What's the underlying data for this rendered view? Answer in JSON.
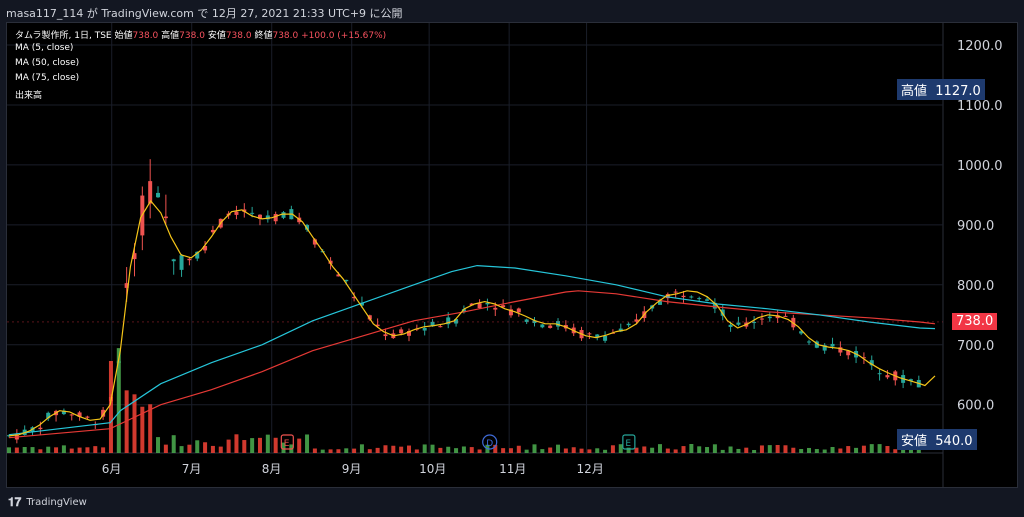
{
  "caption": "masa117_114 が TradingView.com で 12月 27, 2021 21:33 UTC+9 に公開",
  "legend": {
    "symbol": "タムラ製作所, 1日, TSE",
    "ohlc_labels": {
      "open": "始値",
      "high": "高値",
      "low": "安値",
      "close": "終値"
    },
    "open": "738.0",
    "high": "738.0",
    "low": "738.0",
    "close": "738.0",
    "change": "+100.0 (+15.67%)",
    "ma5": "MA (5, close)",
    "ma50": "MA (50, close)",
    "ma75": "MA (75, close)",
    "volume": "出来高"
  },
  "price_axis": {
    "ticks": [
      "1200.0",
      "1100.0",
      "1000.0",
      "900.0",
      "800.0",
      "700.0",
      "600.0"
    ],
    "high_label": "高値",
    "high_value": "1127.0",
    "low_label": "安値",
    "low_value": "540.0",
    "last_value": "738.0"
  },
  "events": [
    "E",
    "D",
    "E"
  ],
  "footer": {
    "logo": "TradingView"
  },
  "colors": {
    "up": "#26a69a",
    "down": "#ef5350",
    "ma5": "#f5c518",
    "ma50": "#26c6da",
    "ma75": "#e53935",
    "vol_up": "#4caf50",
    "vol_down": "#f44336",
    "high_low_tag": "#1e3a6e",
    "last_tag": "#f23645"
  },
  "chart_data": {
    "type": "candlestick",
    "ylim": [
      520,
      1240
    ],
    "months": [
      "6月",
      "7月",
      "8月",
      "9月",
      "10月",
      "11月",
      "12月"
    ],
    "series": [
      {
        "name": "MA (5, close)",
        "x": [
          "6月",
          "7月",
          "8月",
          "9月",
          "10月",
          "11月",
          "12月"
        ]
      },
      {
        "name": "MA (50, close)"
      },
      {
        "name": "MA (75, close)"
      }
    ],
    "ma5": [
      [
        0,
        548
      ],
      [
        4,
        550
      ],
      [
        8,
        556
      ],
      [
        12,
        566
      ],
      [
        16,
        580
      ],
      [
        20,
        590
      ],
      [
        24,
        588
      ],
      [
        28,
        580
      ],
      [
        32,
        574
      ],
      [
        36,
        576
      ],
      [
        40,
        600
      ],
      [
        44,
        690
      ],
      [
        48,
        830
      ],
      [
        52,
        912
      ],
      [
        56,
        940
      ],
      [
        60,
        920
      ],
      [
        64,
        880
      ],
      [
        68,
        850
      ],
      [
        72,
        845
      ],
      [
        76,
        858
      ],
      [
        80,
        880
      ],
      [
        84,
        905
      ],
      [
        88,
        922
      ],
      [
        92,
        925
      ],
      [
        96,
        915
      ],
      [
        100,
        910
      ],
      [
        104,
        912
      ],
      [
        108,
        918
      ],
      [
        112,
        918
      ],
      [
        116,
        905
      ],
      [
        120,
        880
      ],
      [
        124,
        856
      ],
      [
        128,
        830
      ],
      [
        132,
        810
      ],
      [
        136,
        785
      ],
      [
        140,
        760
      ],
      [
        144,
        735
      ],
      [
        148,
        722
      ],
      [
        152,
        715
      ],
      [
        156,
        718
      ],
      [
        160,
        725
      ],
      [
        164,
        730
      ],
      [
        168,
        732
      ],
      [
        172,
        735
      ],
      [
        176,
        740
      ],
      [
        180,
        760
      ],
      [
        184,
        768
      ],
      [
        188,
        772
      ],
      [
        192,
        768
      ],
      [
        196,
        760
      ],
      [
        200,
        755
      ],
      [
        204,
        748
      ],
      [
        208,
        740
      ],
      [
        212,
        735
      ],
      [
        216,
        735
      ],
      [
        220,
        730
      ],
      [
        224,
        722
      ],
      [
        228,
        715
      ],
      [
        232,
        712
      ],
      [
        236,
        716
      ],
      [
        240,
        722
      ],
      [
        244,
        725
      ],
      [
        248,
        735
      ],
      [
        252,
        755
      ],
      [
        256,
        770
      ],
      [
        260,
        782
      ],
      [
        264,
        785
      ],
      [
        268,
        790
      ],
      [
        272,
        788
      ],
      [
        276,
        780
      ],
      [
        280,
        765
      ],
      [
        284,
        740
      ],
      [
        288,
        728
      ],
      [
        292,
        735
      ],
      [
        296,
        745
      ],
      [
        300,
        750
      ],
      [
        304,
        748
      ],
      [
        308,
        742
      ],
      [
        312,
        730
      ],
      [
        316,
        712
      ],
      [
        320,
        700
      ],
      [
        324,
        696
      ],
      [
        328,
        694
      ],
      [
        332,
        690
      ],
      [
        336,
        682
      ],
      [
        340,
        670
      ],
      [
        344,
        660
      ],
      [
        348,
        652
      ],
      [
        352,
        645
      ],
      [
        356,
        640
      ],
      [
        360,
        635
      ],
      [
        362,
        632
      ],
      [
        366,
        648
      ]
    ],
    "ma50": [
      [
        0,
        550
      ],
      [
        20,
        560
      ],
      [
        40,
        570
      ],
      [
        44,
        590
      ],
      [
        60,
        635
      ],
      [
        80,
        670
      ],
      [
        100,
        700
      ],
      [
        120,
        740
      ],
      [
        140,
        770
      ],
      [
        160,
        800
      ],
      [
        175,
        822
      ],
      [
        185,
        832
      ],
      [
        200,
        828
      ],
      [
        220,
        815
      ],
      [
        240,
        800
      ],
      [
        260,
        780
      ],
      [
        280,
        768
      ],
      [
        300,
        760
      ],
      [
        320,
        750
      ],
      [
        340,
        738
      ],
      [
        360,
        728
      ],
      [
        366,
        727
      ]
    ],
    "ma75": [
      [
        0,
        545
      ],
      [
        40,
        560
      ],
      [
        60,
        600
      ],
      [
        80,
        625
      ],
      [
        100,
        655
      ],
      [
        120,
        690
      ],
      [
        140,
        715
      ],
      [
        160,
        740
      ],
      [
        180,
        755
      ],
      [
        200,
        772
      ],
      [
        220,
        788
      ],
      [
        225,
        790
      ],
      [
        240,
        785
      ],
      [
        260,
        772
      ],
      [
        280,
        763
      ],
      [
        300,
        755
      ],
      [
        320,
        750
      ],
      [
        340,
        745
      ],
      [
        360,
        738
      ],
      [
        366,
        735
      ]
    ],
    "candles_note": "daily OHLC approximated from the image"
  }
}
